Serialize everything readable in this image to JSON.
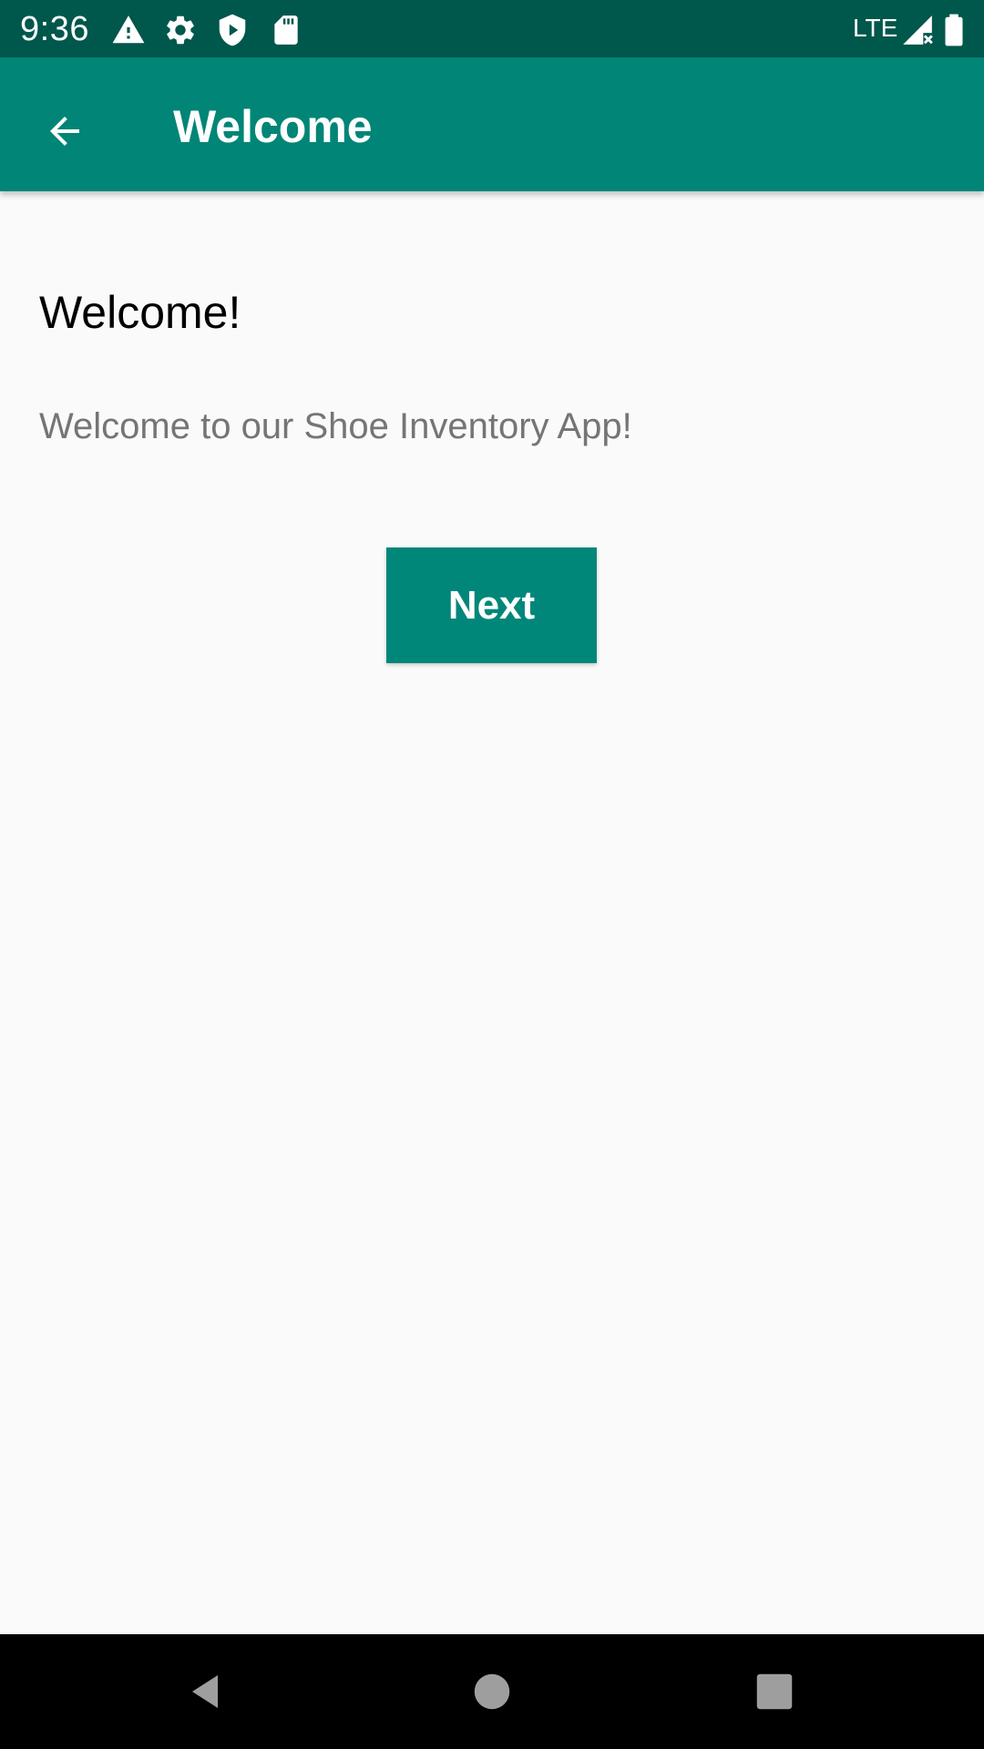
{
  "status_bar": {
    "time": "9:36",
    "network": "LTE",
    "icons": [
      "warning-icon",
      "settings-gear-icon",
      "play-shield-icon",
      "sd-card-icon",
      "signal-icon",
      "battery-icon"
    ]
  },
  "app_bar": {
    "title": "Welcome",
    "back_icon": "arrow-back-icon"
  },
  "content": {
    "heading": "Welcome!",
    "message": "Welcome to our Shoe Inventory App!",
    "next_button_label": "Next"
  },
  "navigation_bar": {
    "buttons": [
      "back-triangle-icon",
      "home-circle-icon",
      "recents-square-icon"
    ]
  },
  "colors": {
    "status_bar": "#00574b",
    "app_bar": "#008577",
    "button": "#00877a",
    "background": "#fafafa",
    "body_text": "#757575"
  }
}
